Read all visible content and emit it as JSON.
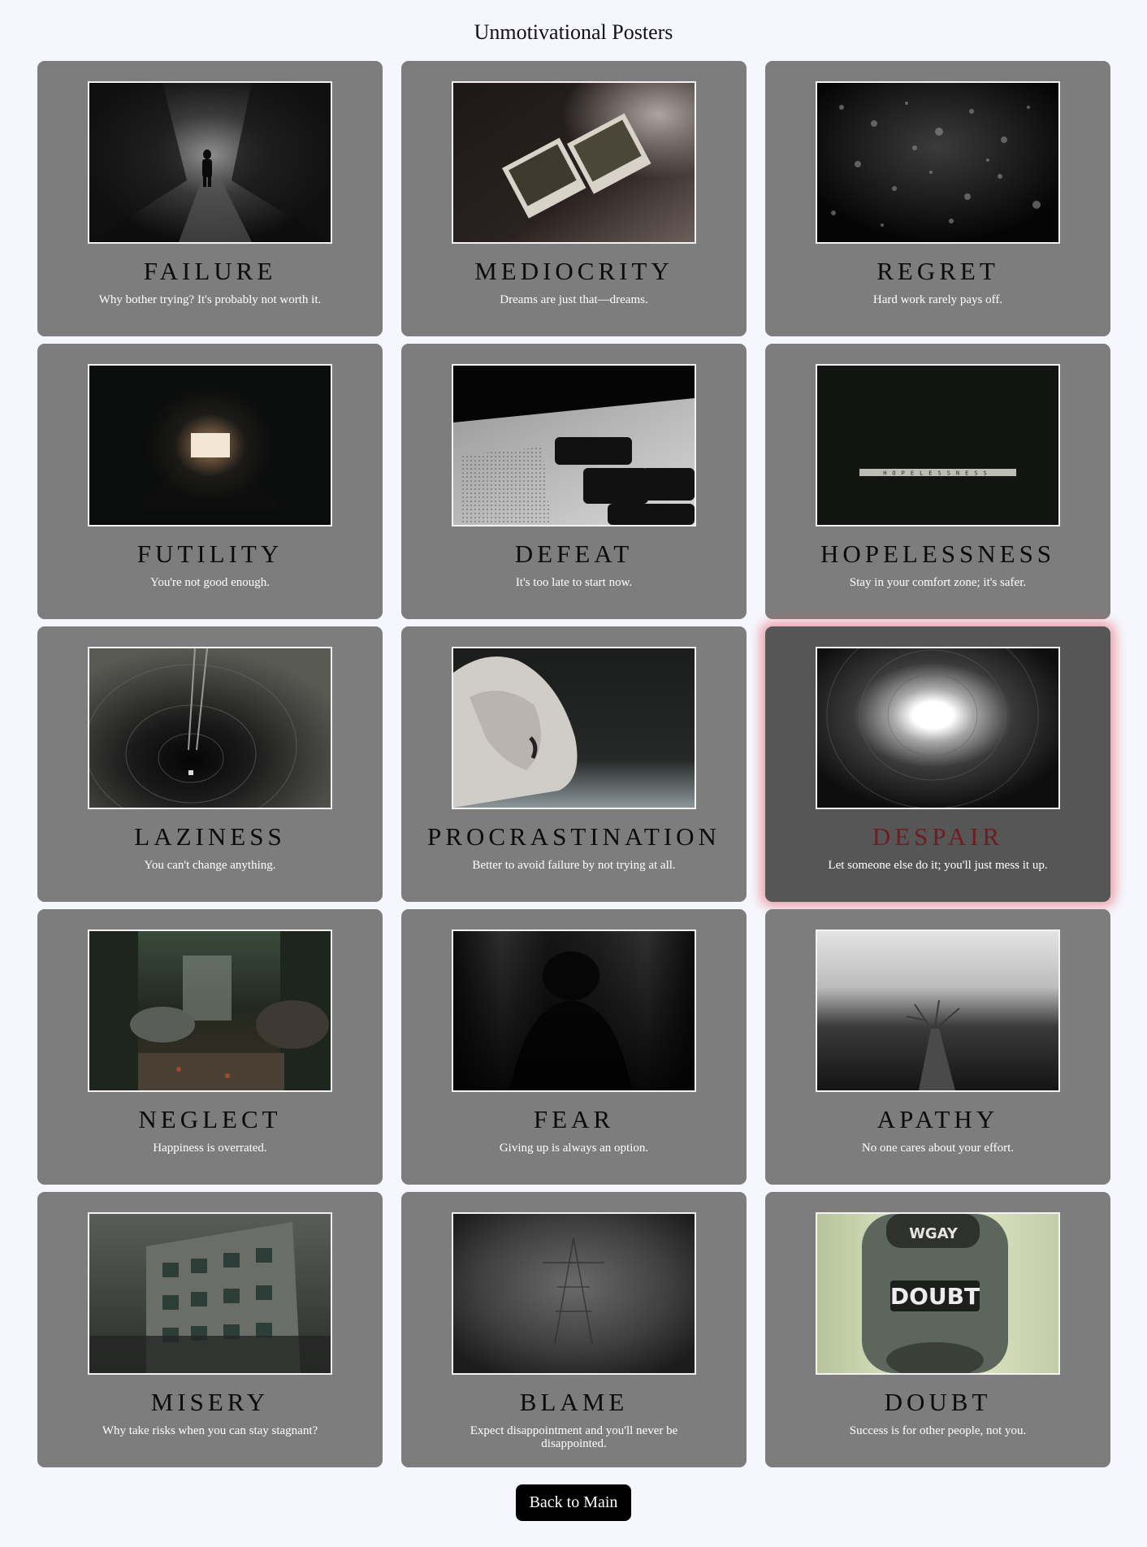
{
  "page": {
    "title": "Unmotivational Posters",
    "back_label": "Back to Main",
    "highlight_color": "#e65a64",
    "title_highlight_color": "#6f1c20"
  },
  "posters": [
    {
      "title": "FAILURE",
      "subtitle": "Why bother trying? It's probably not worth it.",
      "image": "forest-path-silhouette"
    },
    {
      "title": "MEDIOCRITY",
      "subtitle": "Dreams are just that—dreams.",
      "image": "polaroids-on-table"
    },
    {
      "title": "REGRET",
      "subtitle": "Hard work rarely pays off.",
      "image": "raindrops-on-glass"
    },
    {
      "title": "FUTILITY",
      "subtitle": "You're not good enough.",
      "image": "dark-corridor"
    },
    {
      "title": "DEFEAT",
      "subtitle": "It's too late to start now.",
      "image": "laptop-esc-key"
    },
    {
      "title": "HOPELESSNESS",
      "subtitle": "Stay in your comfort zone; it's safer.",
      "image": "letter-tiles",
      "tiles": "HOPELESSNESS"
    },
    {
      "title": "LAZINESS",
      "subtitle": "You can't change anything.",
      "image": "circular-tunnel-ladder"
    },
    {
      "title": "PROCRASTINATION",
      "subtitle": "Better to avoid failure by not trying at all.",
      "image": "broken-pottery"
    },
    {
      "title": "DESPAIR",
      "subtitle": "Let someone else do it; you'll just mess it up.",
      "image": "tunnel-light",
      "highlighted": true
    },
    {
      "title": "NEGLECT",
      "subtitle": "Happiness is overrated.",
      "image": "abandoned-factory"
    },
    {
      "title": "FEAR",
      "subtitle": "Giving up is always an option.",
      "image": "blurry-figure"
    },
    {
      "title": "APATHY",
      "subtitle": "No one cares about your effort.",
      "image": "misty-pier"
    },
    {
      "title": "MISERY",
      "subtitle": "Why take risks when you can stay stagnant?",
      "image": "abandoned-building"
    },
    {
      "title": "BLAME",
      "subtitle": "Expect disappointment and you'll never be disappointed.",
      "image": "foggy-pylon"
    },
    {
      "title": "DOUBT",
      "subtitle": "Success is for other people, not you.",
      "image": "doubt-sticker",
      "sticker_top": "WGAY",
      "sticker_main": "DOUBT"
    }
  ]
}
